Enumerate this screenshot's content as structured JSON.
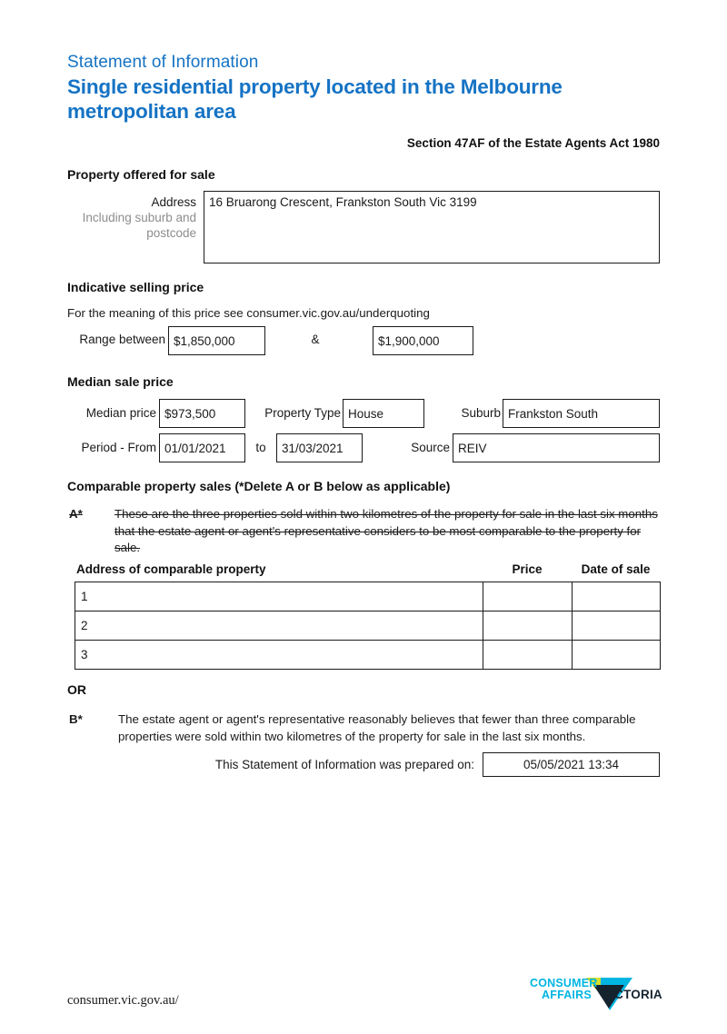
{
  "header": {
    "eyebrow": "Statement of Information",
    "title": "Single residential property located in the Melbourne metropolitan area",
    "act_reference": "Section 47AF of the Estate Agents Act 1980"
  },
  "property_offered": {
    "heading": "Property offered for sale",
    "address_label": "Address",
    "address_sublabel_line1": "Including suburb and",
    "address_sublabel_line2": "postcode",
    "address_value": "16 Bruarong Crescent, Frankston South Vic 3199"
  },
  "indicative_price": {
    "heading": "Indicative selling price",
    "note": "For the meaning of this price see consumer.vic.gov.au/underquoting",
    "range_label": "Range between",
    "range_low": "$1,850,000",
    "ampersand": "&",
    "range_high": "$1,900,000"
  },
  "median_price": {
    "heading": "Median sale price",
    "median_label": "Median price",
    "median_value": "$973,500",
    "property_type_label": "Property Type",
    "property_type_value": "House",
    "suburb_label": "Suburb",
    "suburb_value": "Frankston South",
    "period_label": "Period - From",
    "period_from": "01/01/2021",
    "period_to_label": "to",
    "period_to": "31/03/2021",
    "source_label": "Source",
    "source_value": "REIV"
  },
  "comparable_sales": {
    "heading": "Comparable property sales (*Delete A or B below as applicable)",
    "option_a_marker": "A*",
    "option_a_text": "These are the three properties sold within two kilometres of the property for sale in the last six months that the estate agent or agent's representative considers to be most comparable to the property for sale.",
    "columns": [
      "Address of comparable property",
      "Price",
      "Date of sale"
    ],
    "rows": [
      {
        "number": "1",
        "address": "",
        "price": "",
        "date_of_sale": ""
      },
      {
        "number": "2",
        "address": "",
        "price": "",
        "date_of_sale": ""
      },
      {
        "number": "3",
        "address": "",
        "price": "",
        "date_of_sale": ""
      }
    ],
    "or_label": "OR",
    "option_b_marker": "B*",
    "option_b_text": "The estate agent or agent's representative reasonably believes that fewer than three comparable properties were sold within two kilometres of the property for sale in the last six months."
  },
  "prepared": {
    "label": "This Statement of Information was prepared on:",
    "value": "05/05/2021 13:34"
  },
  "footer": {
    "url": "consumer.vic.gov.au/",
    "logo_line1": "CONSUMER",
    "logo_line2": "AFFAIRS",
    "logo_word": "VICTORIA"
  },
  "colors": {
    "brand_blue": "#1673c4",
    "logo_cyan": "#00b5e2",
    "logo_yellow": "#d4e02a",
    "logo_navy": "#15232f",
    "border": "#1a1a1a",
    "muted_text": "#8d8d8d"
  }
}
